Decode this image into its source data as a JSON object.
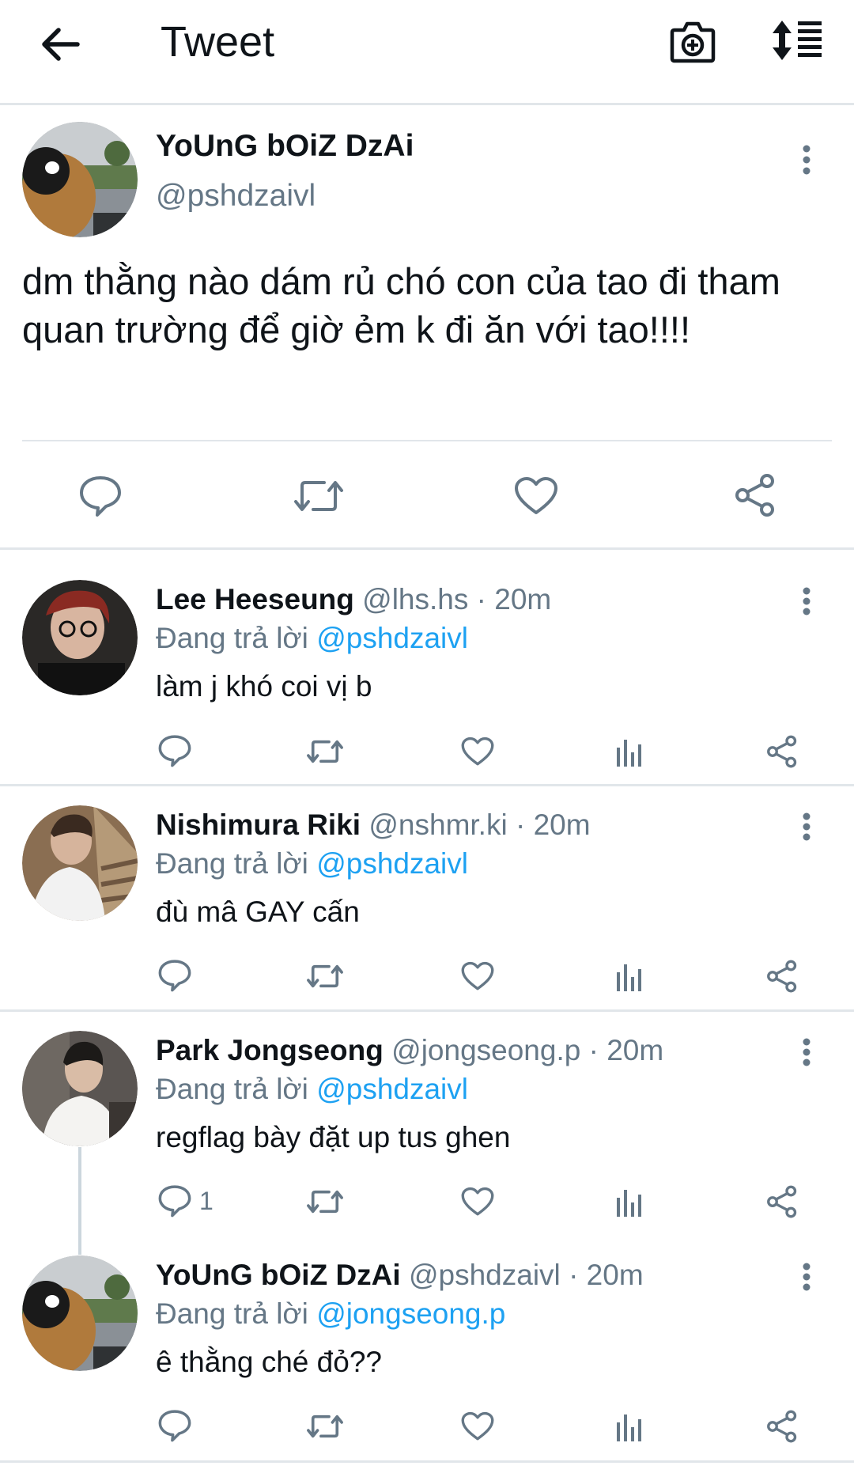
{
  "header": {
    "title": "Tweet"
  },
  "colors": {
    "accent": "#1da1f2",
    "secondary_text": "#657786",
    "icon": "#657786",
    "divider": "#e1e6ea"
  },
  "main_tweet": {
    "display_name": "YoUnG bOiZ DzAi",
    "handle": "@pshdzaivl",
    "text": "dm thằng nào dám rủ chó con của tao đi tham quan trường để giờ ẻm k đi ăn với tao!!!!"
  },
  "replies": [
    {
      "display_name": "Lee Heeseung",
      "handle": "@lhs.hs",
      "time": "· 20m",
      "replying_label": "Đang trả lời",
      "replying_to": "@pshdzaivl",
      "text": "làm j khó coi vị b",
      "reply_count": ""
    },
    {
      "display_name": "Nishimura Riki",
      "handle": "@nshmr.ki",
      "time": "· 20m",
      "replying_label": "Đang trả lời",
      "replying_to": "@pshdzaivl",
      "text": "đù mâ GAY cấn",
      "reply_count": ""
    },
    {
      "display_name": "Park Jongseong",
      "handle": "@jongseong.p",
      "time": "· 20m",
      "replying_label": "Đang trả lời",
      "replying_to": "@pshdzaivl",
      "text": "regflag bày đặt up tus ghen",
      "reply_count": "1"
    },
    {
      "display_name": "YoUnG bOiZ DzAi",
      "handle": "@pshdzaivl",
      "time": "· 20m",
      "replying_label": "Đang trả lời",
      "replying_to": "@jongseong.p",
      "text": "ê thằng ché đỏ??",
      "reply_count": ""
    }
  ]
}
